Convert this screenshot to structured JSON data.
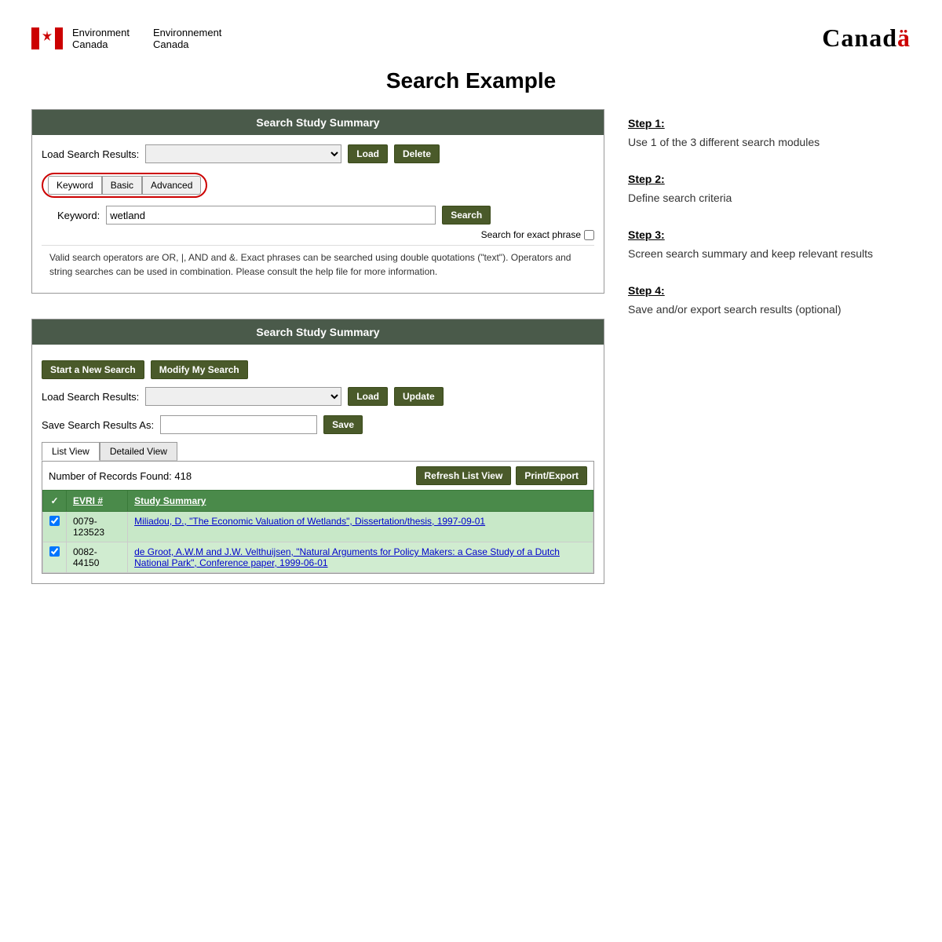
{
  "header": {
    "org_en_line1": "Environment",
    "org_en_line2": "Canada",
    "org_fr_line1": "Environnement",
    "org_fr_line2": "Canada",
    "canada_logo": "Canad",
    "canada_logo_a": "ä"
  },
  "page": {
    "title": "Search Example"
  },
  "search_panel_1": {
    "header": "Search Study Summary",
    "load_label": "Load Search Results:",
    "load_btn": "Load",
    "delete_btn": "Delete",
    "tabs": [
      "Keyword",
      "Basic",
      "Advanced"
    ],
    "active_tab": "Keyword",
    "keyword_label": "Keyword:",
    "keyword_value": "wetland",
    "search_btn": "Search",
    "exact_phrase_label": "Search for exact phrase",
    "help_text": "Valid search operators are OR, |, AND and &. Exact phrases can be searched using double quotations (\"text\"). Operators and string searches can be used in combination. Please consult the help file for more information."
  },
  "search_panel_2": {
    "header": "Search Study Summary",
    "start_new_search_btn": "Start a New Search",
    "modify_search_btn": "Modify My Search",
    "load_label": "Load Search Results:",
    "load_btn": "Load",
    "update_btn": "Update",
    "save_label": "Save Search Results As:",
    "save_btn": "Save",
    "view_tabs": [
      "List View",
      "Detailed View"
    ],
    "active_view_tab": "List View",
    "records_count": "Number of Records Found: 418",
    "refresh_btn": "Refresh List View",
    "print_btn": "Print/Export",
    "table": {
      "columns": [
        "✓",
        "EVRI #",
        "Study Summary"
      ],
      "rows": [
        {
          "checked": true,
          "evri": "0079-123523",
          "summary": "Miliadou, D., \"The Economic Valuation of Wetlands\", Dissertation/thesis, 1997-09-01"
        },
        {
          "checked": true,
          "evri": "0082-44150",
          "summary": "de Groot, A.W.M and J.W. Velthuijsen, \"Natural Arguments for Policy Makers: a Case Study of a Dutch National Park\", Conference paper, 1999-06-01"
        }
      ]
    }
  },
  "steps": [
    {
      "title": "Step 1:",
      "text": "Use 1 of the 3 different search modules"
    },
    {
      "title": "Step 2:",
      "text": "Define search criteria"
    },
    {
      "title": "Step 3:",
      "text": "Screen search summary and keep relevant results"
    },
    {
      "title": "Step 4:",
      "text": "Save and/or export search results (optional)"
    }
  ]
}
